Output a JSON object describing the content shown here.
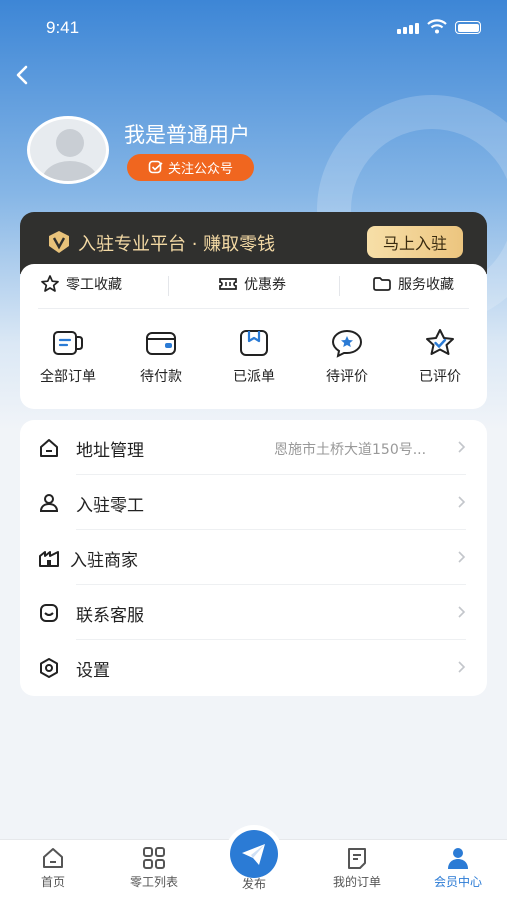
{
  "status_bar": {
    "time": "9:41"
  },
  "profile": {
    "username": "我是普通用户",
    "follow_label": "关注公众号"
  },
  "vip": {
    "text": "入驻专业平台 · 赚取零钱",
    "button": "马上入驻",
    "colors": {
      "bar": "#30302e",
      "text": "#f3d9a4",
      "button": "#ecc57f"
    }
  },
  "favorites": [
    {
      "icon": "star-icon",
      "label": "零工收藏"
    },
    {
      "icon": "ticket-icon",
      "label": "优惠券"
    },
    {
      "icon": "folder-icon",
      "label": "服务收藏"
    }
  ],
  "orders": [
    {
      "icon": "order-list-icon",
      "label": "全部订单"
    },
    {
      "icon": "wallet-icon",
      "label": "待付款"
    },
    {
      "icon": "box-icon",
      "label": "已派单"
    },
    {
      "icon": "chat-star-icon",
      "label": "待评价"
    },
    {
      "icon": "star-check-icon",
      "label": "已评价"
    }
  ],
  "menu": [
    {
      "icon": "home-icon",
      "label": "地址管理",
      "value": "恩施市土桥大道150号..."
    },
    {
      "icon": "person-icon",
      "label": "入驻零工",
      "value": ""
    },
    {
      "icon": "shop-icon",
      "label": "入驻商家",
      "value": ""
    },
    {
      "icon": "service-icon",
      "label": "联系客服",
      "value": ""
    },
    {
      "icon": "settings-icon",
      "label": "设置",
      "value": ""
    }
  ],
  "tabbar": {
    "items": [
      {
        "icon": "home-icon",
        "label": "首页"
      },
      {
        "icon": "grid-icon",
        "label": "零工列表"
      },
      {
        "icon": "send-icon",
        "label": "发布"
      },
      {
        "icon": "orders-icon",
        "label": "我的订单"
      },
      {
        "icon": "member-icon",
        "label": "会员中心"
      }
    ],
    "active_index": 4,
    "active_color": "#2b7bd5"
  }
}
